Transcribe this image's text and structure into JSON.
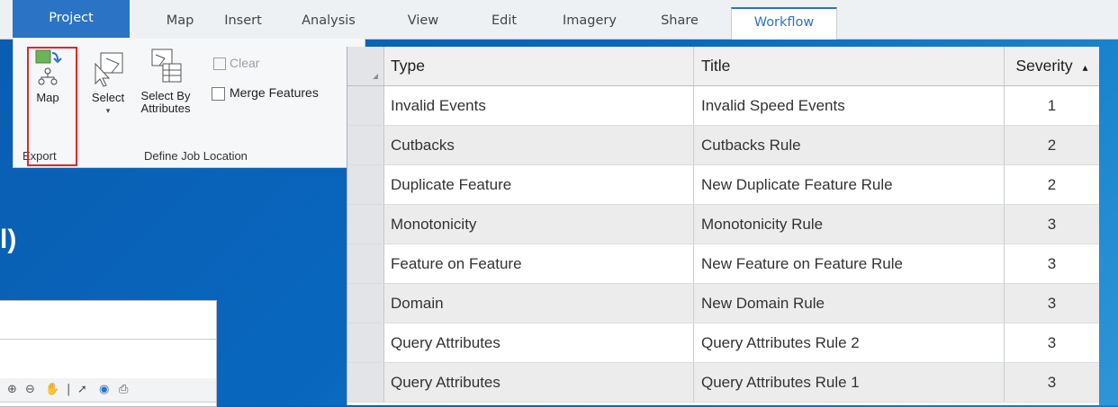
{
  "tabs": [
    {
      "label": "Project"
    },
    {
      "label": "Map"
    },
    {
      "label": "Insert"
    },
    {
      "label": "Analysis"
    },
    {
      "label": "View"
    },
    {
      "label": "Edit"
    },
    {
      "label": "Imagery"
    },
    {
      "label": "Share"
    },
    {
      "label": "Workflow"
    }
  ],
  "ribbon": {
    "export_group": {
      "button_label": "Map",
      "group_label": "Export"
    },
    "job_location_group": {
      "select_label": "Select",
      "select_by_label_1": "Select By",
      "select_by_label_2": "Attributes",
      "clear_label": "Clear",
      "merge_label": "Merge Features",
      "group_label": "Define Job Location"
    }
  },
  "background_text": "l)",
  "table": {
    "columns": [
      "Type",
      "Title",
      "Severity"
    ],
    "sort_indicator": "▴",
    "rows": [
      {
        "type": "Invalid Events",
        "title": "Invalid Speed Events",
        "severity": "1"
      },
      {
        "type": "Cutbacks",
        "title": "Cutbacks Rule",
        "severity": "2"
      },
      {
        "type": "Duplicate Feature",
        "title": "New Duplicate Feature Rule",
        "severity": "2"
      },
      {
        "type": "Monotonicity",
        "title": "Monotonicity Rule",
        "severity": "3"
      },
      {
        "type": "Feature on Feature",
        "title": "New Feature on Feature Rule",
        "severity": "3"
      },
      {
        "type": "Domain",
        "title": "New Domain Rule",
        "severity": "3"
      },
      {
        "type": "Query Attributes",
        "title": "Query Attributes Rule 2",
        "severity": "3"
      },
      {
        "type": "Query Attributes",
        "title": "Query Attributes Rule 1",
        "severity": "3"
      }
    ]
  },
  "colors": {
    "accent": "#2b73c4",
    "highlight_border": "#e0262b",
    "background": "#0867bd"
  }
}
